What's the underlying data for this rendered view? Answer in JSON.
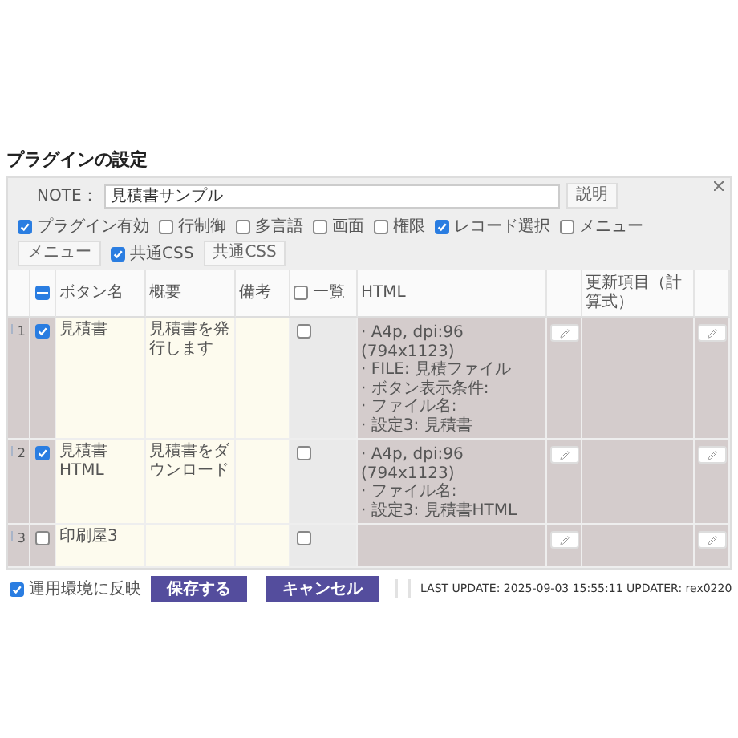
{
  "title": "プラグインの設定",
  "note": {
    "label": "NOTE：",
    "value": "見積書サンプル",
    "button": "説明"
  },
  "options": [
    {
      "kind": "check",
      "label": "プラグイン有効",
      "checked": true
    },
    {
      "kind": "check",
      "label": "行制御",
      "checked": false
    },
    {
      "kind": "check",
      "label": "多言語",
      "checked": false
    },
    {
      "kind": "check",
      "label": "画面",
      "checked": false
    },
    {
      "kind": "check",
      "label": "権限",
      "checked": false
    },
    {
      "kind": "check",
      "label": "レコード選択",
      "checked": true
    },
    {
      "kind": "check",
      "label": "メニュー",
      "checked": false
    },
    {
      "kind": "button",
      "label": "メニュー"
    },
    {
      "kind": "check",
      "label": "共通CSS",
      "checked": true
    },
    {
      "kind": "button",
      "label": "共通CSS"
    }
  ],
  "table": {
    "select_all_partial": true,
    "list_all_checked": false,
    "columns": [
      "ボタン名",
      "概要",
      "備考",
      "一覧",
      "HTML",
      "更新項目（計算式）"
    ],
    "rows": [
      {
        "number": "1",
        "checked": true,
        "name": "見積書",
        "summary": "見積書を発行します",
        "in_list": false,
        "html": [
          "· A4p, dpi:96 (794x1123)",
          "· FILE: 見積ファイル",
          "· ボタン表示条件:",
          "· ファイル名:",
          "· 設定3: 見積書"
        ]
      },
      {
        "number": "2",
        "checked": true,
        "name": "見積書HTML",
        "summary": "見積書をダウンロード",
        "in_list": false,
        "html": [
          "· A4p, dpi:96 (794x1123)",
          "· ファイル名:",
          "· 設定3: 見積書HTML"
        ]
      },
      {
        "number": "3",
        "checked": false,
        "name": "印刷屋3",
        "summary": "",
        "in_list": false,
        "html": []
      }
    ]
  },
  "footer": {
    "reflect": {
      "label": "運用環境に反映",
      "checked": true
    },
    "save": "保存する",
    "cancel": "キャンセル",
    "last_update": "LAST UPDATE: 2025-09-03 15:55:11 UPDATER: rex0220"
  }
}
